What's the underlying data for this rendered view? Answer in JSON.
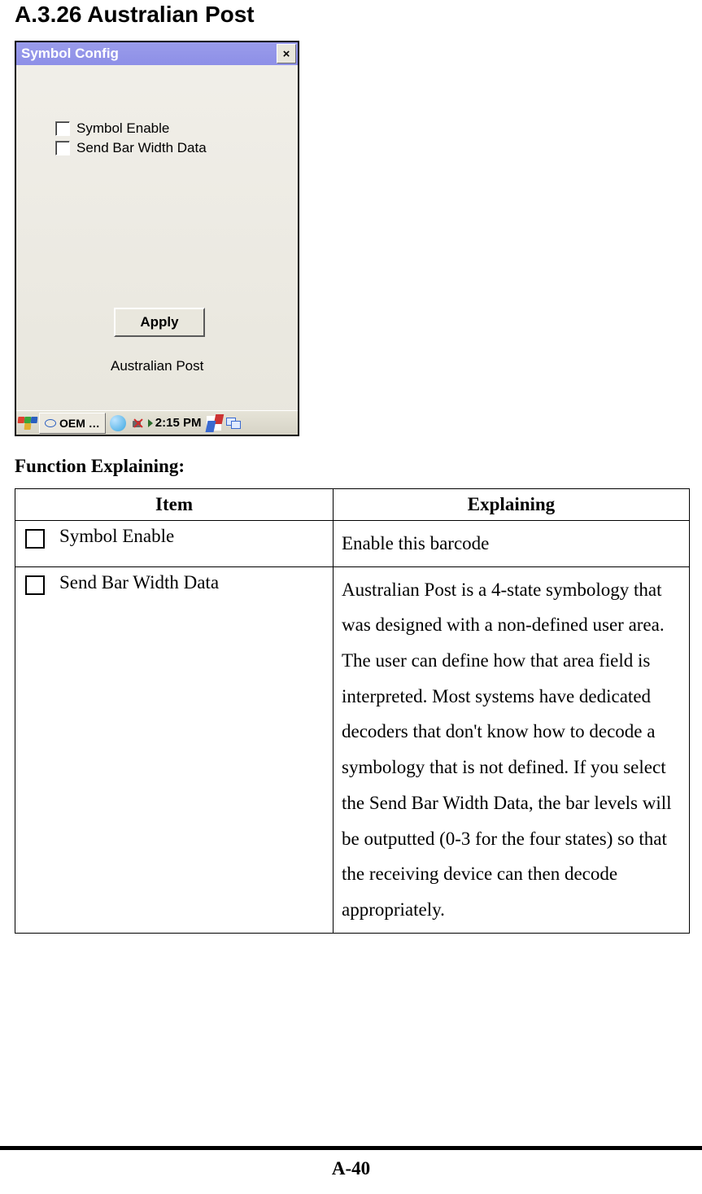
{
  "heading": "A.3.26 Australian Post",
  "window": {
    "title": "Symbol Config",
    "close_symbol": "×",
    "checkboxes": [
      {
        "label": "Symbol Enable"
      },
      {
        "label": "Send Bar Width Data"
      }
    ],
    "apply_label": "Apply",
    "panel_label": "Australian Post"
  },
  "taskbar": {
    "app_label": "OEM …",
    "clock": "2:15 PM"
  },
  "function_heading": "Function Explaining:",
  "table": {
    "headers": {
      "item": "Item",
      "explaining": "Explaining"
    },
    "rows": [
      {
        "item": "Symbol Enable",
        "explaining": "Enable this barcode"
      },
      {
        "item": "Send Bar Width Data",
        "explaining": "Australian Post is a 4-state symbology that was designed with a non-defined user area. The user can define how that area field is interpreted. Most systems have dedicated decoders that don't know how to decode a symbology that is not defined. If you select the Send Bar Width Data, the bar levels will be outputted (0-3 for the four states) so that the receiving device can then decode appropriately."
      }
    ]
  },
  "page_number": "A-40"
}
